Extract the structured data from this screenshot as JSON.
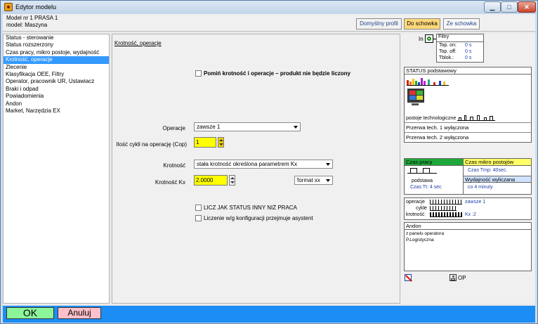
{
  "window": {
    "title": "Edytor modelu"
  },
  "header": {
    "model_nr": "Model nr 1  PRASA 1",
    "model_name": "model: Maszyna",
    "btn_default": "Domyślny profil",
    "btn_to_clipboard": "Do schowka",
    "btn_from_clipboard": "Ze schowka"
  },
  "nav": {
    "items": [
      {
        "label": "Status - sterowanie"
      },
      {
        "label": "Status rozszerzony"
      },
      {
        "label": "Czas pracy, mikro postoje, wydajność"
      },
      {
        "label": "Krotność, operacje"
      },
      {
        "label": "Zlecenie"
      },
      {
        "label": "Klasyfikacja OEE, Filtry"
      },
      {
        "label": "Operator, pracownik UR, Ustawiacz"
      },
      {
        "label": "Braki i odpad"
      },
      {
        "label": "Powiadomienia"
      },
      {
        "label": "Andon"
      },
      {
        "label": "Market, Narzędzia EX"
      }
    ],
    "selected_index": 3
  },
  "main": {
    "section_title": "Krotność, operacje",
    "skip_checkbox_label": "Pomiń krotność i operacje – produkt nie będzie liczony",
    "operations_label": "Operacje",
    "operations_value": "zawsze 1",
    "cycles_label": "Ilość cykli na operację (Cop)",
    "cycles_value": "1",
    "multiplicity_label": "Krotność",
    "multiplicity_value": "stała krotność określona parametrem Kx",
    "kx_label": "Krotność Kx",
    "kx_value": "2.0000",
    "format_value": "format xx",
    "count_status_label": "LICZ JAK STATUS INNY NIŻ PRACA",
    "assistant_label": "Liczenie w/g konfiguracji przejmuje asystent"
  },
  "right": {
    "in_label": "In",
    "filters_title": "Filtry",
    "filters_rows": [
      {
        "label": "Top. on:",
        "value": "0 s"
      },
      {
        "label": "Top. off:",
        "value": "0 s"
      },
      {
        "label": "Tblok.:",
        "value": "0 s"
      }
    ],
    "status_title": "STATUS podstawowy",
    "tech_label": "postoje technologiczne",
    "break1": "Przerwa tech. 1 wyłączona",
    "break2": "Przerwa tech. 2 wyłączona",
    "worktime_title": "Czas pracy",
    "micro_title": "Czas mikro postojów",
    "micro_value": "Czas Tmp: 40sec.",
    "base_label": "podstawa",
    "tt_value": "Czas Tt: 4 sec",
    "efficiency_title": "Wydajność wyliczana",
    "efficiency_value": "co 4 minuty",
    "ops_label": "operacje",
    "ops_value": "zawsze 1",
    "cycles_label": "cykle",
    "mult_label": "krotność",
    "mult_value": "Kx :2",
    "andon_title": "Andon",
    "andon_line1": "z panelu operatora",
    "andon_line2": "P.Logistyczna",
    "op_label": "OP"
  },
  "footer": {
    "ok": "OK",
    "cancel": "Anuluj"
  },
  "colors": {
    "selected": "#3399ff",
    "footer": "#1c8df5",
    "ok": "#8cf59a",
    "cancel": "#ffc0cb",
    "yellow_input": "#ffff00"
  }
}
